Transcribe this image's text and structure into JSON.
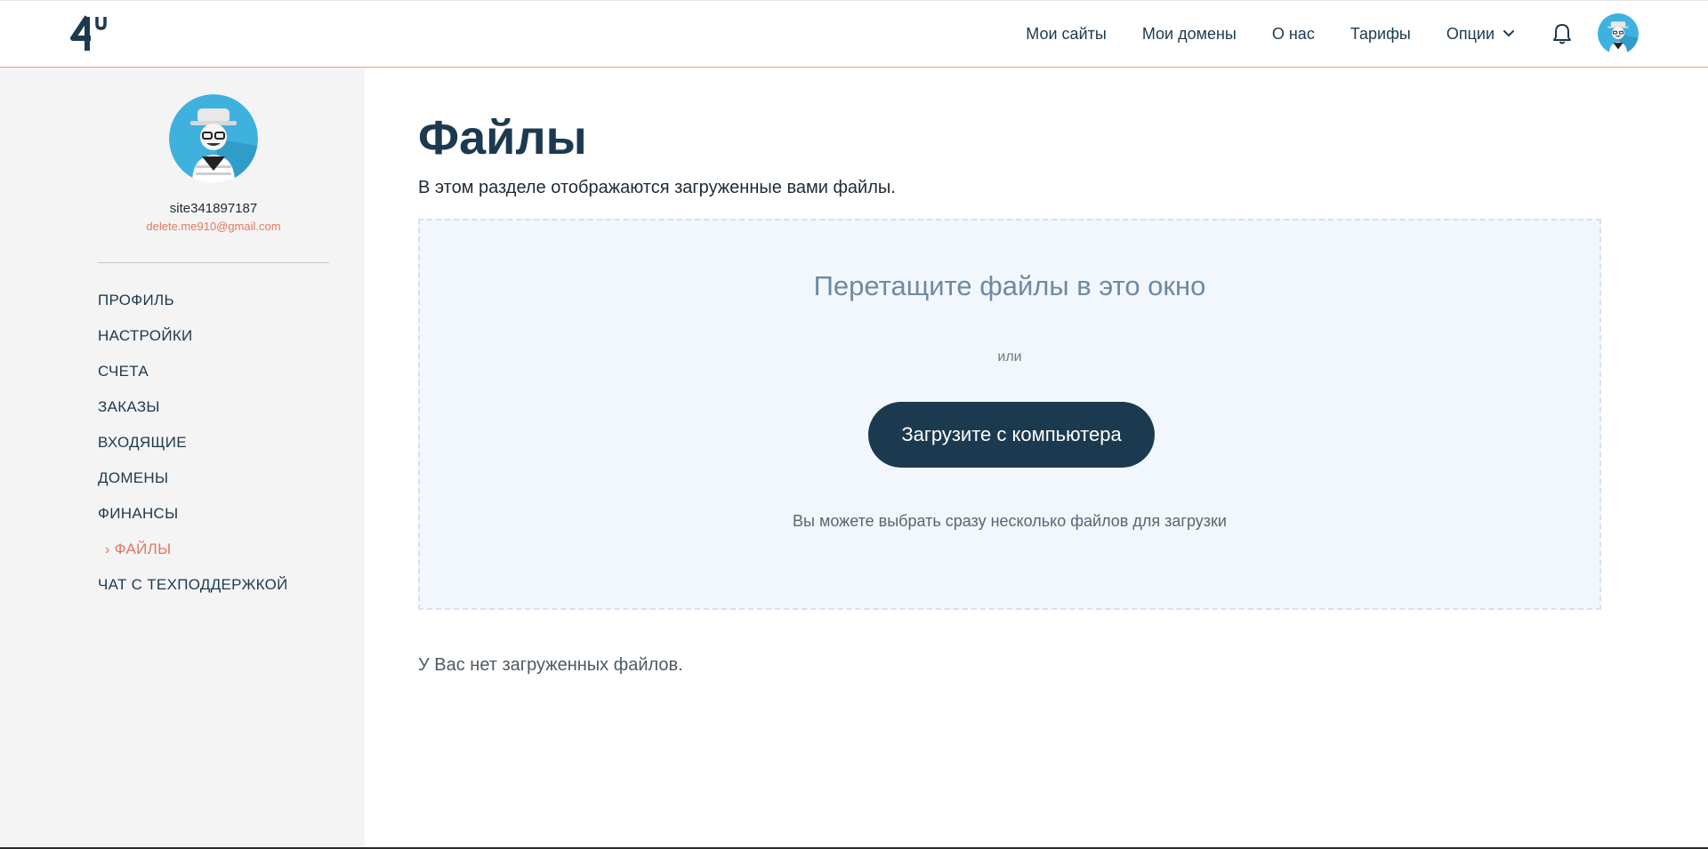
{
  "header": {
    "logo_text": "4u",
    "nav": [
      {
        "label": "Мои сайты"
      },
      {
        "label": "Мои домены"
      },
      {
        "label": "О нас"
      },
      {
        "label": "Тарифы"
      },
      {
        "label": "Опции"
      }
    ]
  },
  "sidebar": {
    "username": "site341897187",
    "email": "delete.me910@gmail.com",
    "menu": [
      {
        "label": "ПРОФИЛЬ"
      },
      {
        "label": "НАСТРОЙКИ"
      },
      {
        "label": "СЧЕТА"
      },
      {
        "label": "ЗАКАЗЫ"
      },
      {
        "label": "ВХОДЯЩИЕ"
      },
      {
        "label": "ДОМЕНЫ"
      },
      {
        "label": "ФИНАНСЫ"
      },
      {
        "label": "ФАЙЛЫ",
        "active": true
      },
      {
        "label": "ЧАТ С ТЕХПОДДЕРЖКОЙ"
      }
    ]
  },
  "main": {
    "title": "Файлы",
    "subtitle": "В этом разделе отображаются загруженные вами файлы.",
    "dropzone": {
      "title": "Перетащите файлы в это окно",
      "or": "или",
      "button": "Загрузите с компьютера",
      "hint": "Вы можете выбрать сразу несколько файлов для загрузки"
    },
    "empty_message": "У Вас нет загруженных файлов."
  },
  "colors": {
    "primary": "#1c3a4f",
    "accent": "#e27862",
    "dropzone_bg": "#f2f6fd",
    "sidebar_bg": "#f4f4f4"
  }
}
